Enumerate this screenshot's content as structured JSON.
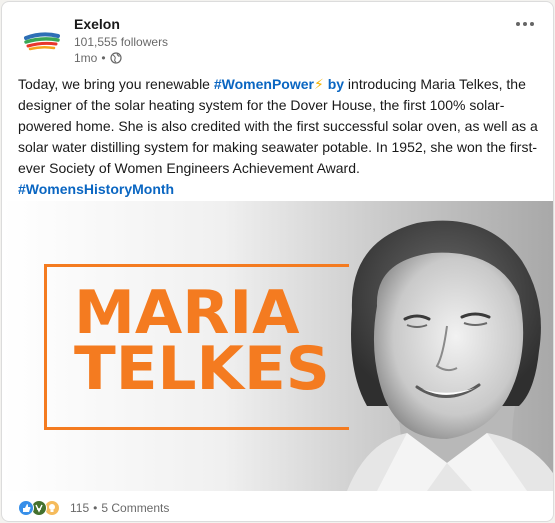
{
  "author": {
    "name": "Exelon",
    "followers": "101,555 followers",
    "time": "1mo",
    "visibility_icon": "globe-icon",
    "logo_colors": [
      "#2e6fb5",
      "#3aa655",
      "#e8372c",
      "#f6a31b"
    ]
  },
  "post": {
    "text_1": "Today, we bring you renewable ",
    "hashtag_1": "#WomenPower",
    "emoji": "⚡",
    "hashtag_2": " by",
    "text_2": " introducing Maria Telkes, the designer of the solar heating system for the Dover House, the first 100% solar-powered home. She is also credited with the first successful solar oven, as well as a solar water distilling system for making seawater potable. In 1952, she won the first-ever Society of Women Engineers Achievement Award.",
    "hashtag_3": "#WomensHistoryMonth"
  },
  "image": {
    "headline_line1": "MARIA",
    "headline_line2": "TELKES",
    "accent_color": "#f47b20"
  },
  "social": {
    "reaction_icons": [
      "like-icon",
      "celebrate-icon",
      "insightful-icon"
    ],
    "reaction_count": "115",
    "separator": "•",
    "comments": "5 Comments"
  },
  "colors": {
    "link": "#0a66c2"
  }
}
